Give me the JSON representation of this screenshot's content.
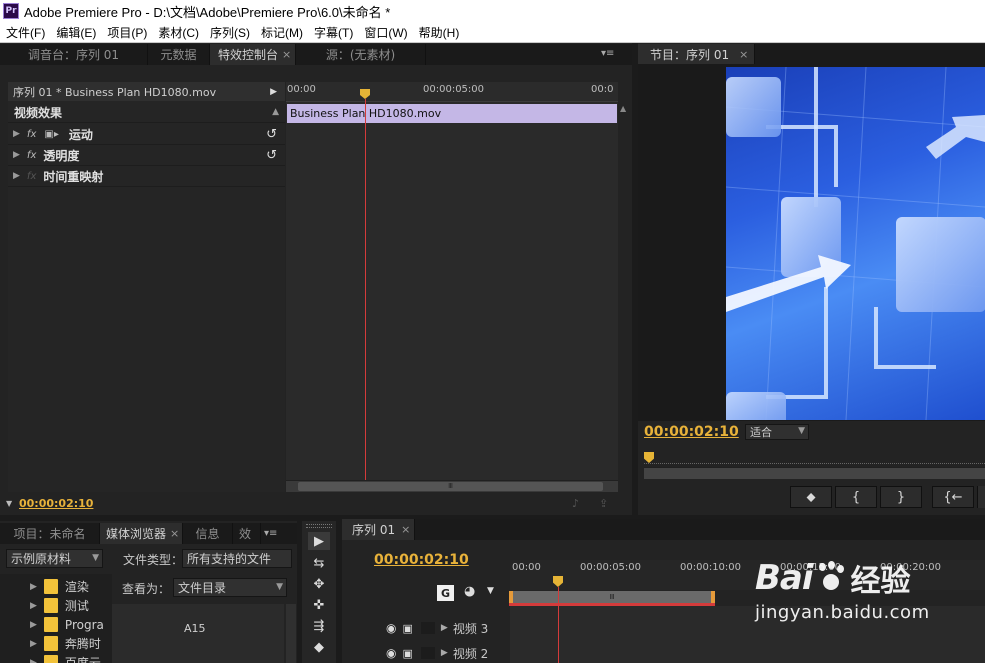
{
  "window": {
    "app_icon": "Pr",
    "title": "Adobe Premiere Pro - D:\\文档\\Adobe\\Premiere Pro\\6.0\\未命名 *"
  },
  "menu": [
    "文件(F)",
    "编辑(E)",
    "项目(P)",
    "素材(C)",
    "序列(S)",
    "标记(M)",
    "字幕(T)",
    "窗口(W)",
    "帮助(H)"
  ],
  "source_panel": {
    "tabs": [
      {
        "label": "调音台：序列 01",
        "active": false
      },
      {
        "label": "元数据",
        "active": false
      },
      {
        "label": "特效控制台",
        "active": true,
        "closable": true
      },
      {
        "label": "源：(无素材)",
        "active": false
      }
    ],
    "panel_menu_icon": "▾≡"
  },
  "effect_controls": {
    "clip_header": "序列 01 * Business Plan HD1080.mov",
    "section_label": "视频效果",
    "effects": [
      {
        "name": "运动",
        "has_reset": true
      },
      {
        "name": "透明度",
        "has_reset": true
      },
      {
        "name": "时间重映射",
        "has_reset": false
      }
    ],
    "ruler_labels": [
      "00:00",
      "00:00:05:00",
      "00:0"
    ],
    "clip_name": "Business Plan HD1080.mov",
    "current_time": "00:00:02:10",
    "scroll_grip": "Ⅲ"
  },
  "program_monitor": {
    "tab_label": "节目：序列 01",
    "timecode": "00:00:02:10",
    "zoom_option": "适合",
    "buttons": [
      "⬥",
      "{",
      "}",
      "{←"
    ]
  },
  "project_panel": {
    "tabs": [
      {
        "label": "项目：未命名",
        "active": false
      },
      {
        "label": "媒体浏览器",
        "active": true,
        "closable": true
      },
      {
        "label": "信息",
        "active": false
      },
      {
        "label": "效",
        "active": false
      }
    ],
    "source_dropdown": "示例原材料",
    "file_type_label": "文件类型：",
    "file_type_value": "所有支持的文件",
    "view_as_label": "查看为：",
    "view_as_value": "文件目录",
    "folders": [
      "渲染",
      "测试",
      "Progra",
      "奔腾时",
      "百度云"
    ],
    "preview_label": "A15"
  },
  "tools": [
    "▶",
    "⇆",
    "✥",
    "✜",
    "⇶",
    "◆"
  ],
  "timeline": {
    "tab_label": "序列 01",
    "timecode": "00:00:02:10",
    "ruler_labels": [
      "00:00",
      "00:00:05:00",
      "00:00:10:00",
      "00:00:15:00",
      "00:00:20:00"
    ],
    "tracks": [
      "视频 3",
      "视频 2"
    ],
    "work_area_grip": "Ⅲ"
  },
  "watermark": {
    "brand": "Bai",
    "brand_cn": "经验",
    "url": "jingyan.baidu.com"
  },
  "colors": {
    "timecode": "#e8b23a",
    "playhead": "#d43b3b",
    "clip": "#c4b7e6",
    "work_area": "#e59a3a"
  }
}
